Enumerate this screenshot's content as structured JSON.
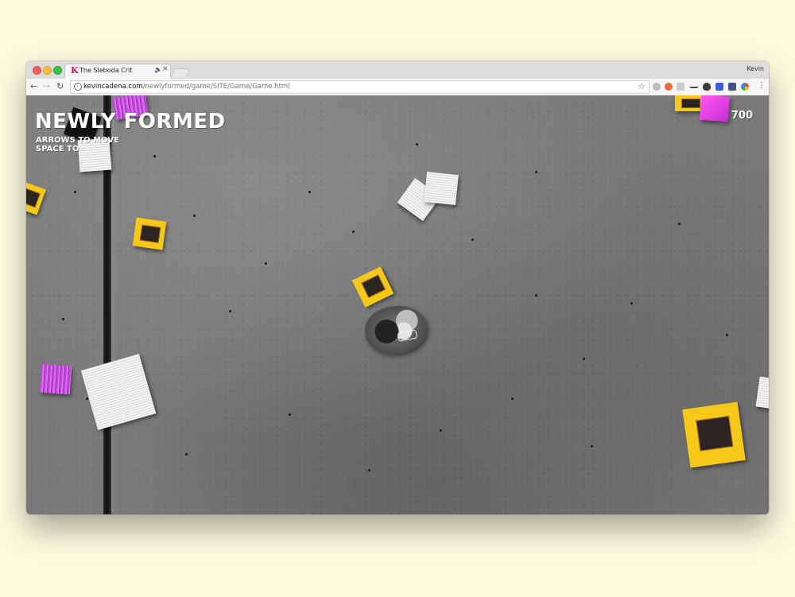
{
  "browser": {
    "tab": {
      "favicon": "K",
      "title": "The Sleboda Crit",
      "audio_icon": "speaker-icon",
      "close_label": "×"
    },
    "profile_name": "Kevin",
    "url_host": "kevincadena.com",
    "url_path": "/newlyformed/game/SITE/Game/Game.html",
    "colors": {
      "traffic_red": "#fc605c",
      "traffic_yellow": "#fdbc40",
      "traffic_green": "#34c84a"
    }
  },
  "game": {
    "title": "NEWLY FORMED",
    "instructions": [
      "ARROWS TO MOVE",
      "SPACE TO"
    ],
    "score": "700",
    "background": "concrete-floor",
    "collectibles": [
      "yellow-record-cover",
      "magenta-record-cover",
      "white-record-cover",
      "black-record-cover"
    ]
  }
}
